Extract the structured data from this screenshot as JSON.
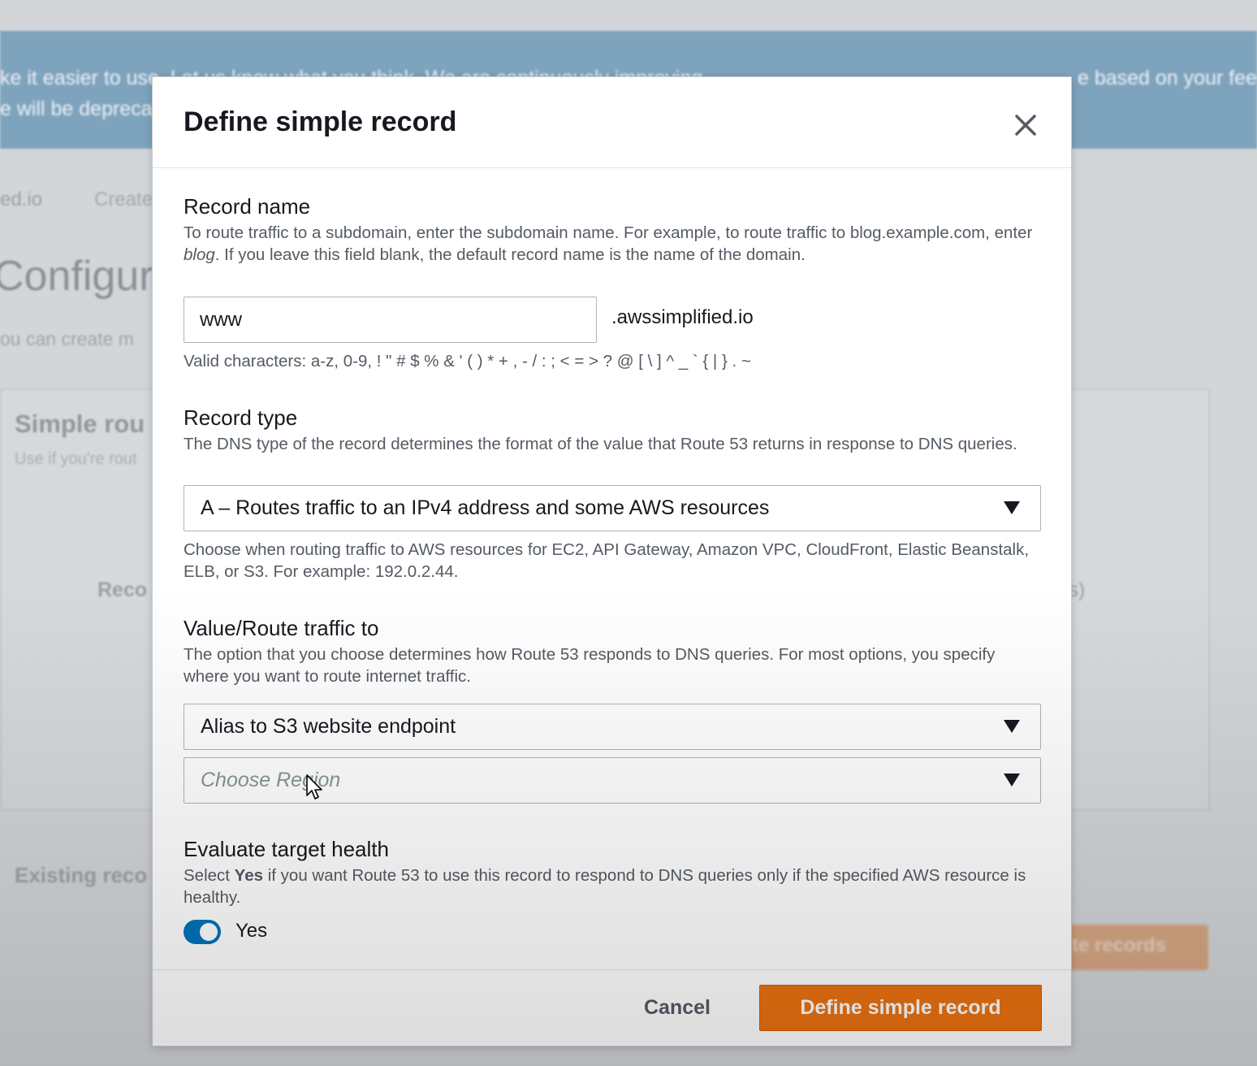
{
  "background": {
    "banner_line1": "ke it easier to use. Let us know what you think. We are continuously improving",
    "banner_line2": "e will be deprecated",
    "banner_right": "e based on your fee",
    "breadcrumb_domain": "ed.io",
    "breadcrumb_create": "Create",
    "page_title": "Configur",
    "page_subtitle": "ou can create m",
    "panel_title": "Simple rou",
    "panel_subtitle": "Use if you're rout",
    "record_col": "Reco",
    "right_col": "ls)",
    "existing_records": "Existing reco",
    "create_records_button": "te records"
  },
  "modal": {
    "title": "Define simple record",
    "record_name": {
      "label": "Record name",
      "description_pre": "To route traffic to a subdomain, enter the subdomain name. For example, to route traffic to blog.example.com, enter ",
      "description_em": "blog",
      "description_post": ". If you leave this field blank, the default record name is the name of the domain.",
      "value": "www",
      "suffix": ".awssimplified.io",
      "hint": "Valid characters: a-z, 0-9, ! \" # $ % & ' ( ) * + , - / : ; < = > ? @ [ \\ ] ^ _ ` { | } . ~"
    },
    "record_type": {
      "label": "Record type",
      "description": "The DNS type of the record determines the format of the value that Route 53 returns in response to DNS queries.",
      "selected": "A – Routes traffic to an IPv4 address and some AWS resources",
      "help": "Choose when routing traffic to AWS resources for EC2, API Gateway, Amazon VPC, CloudFront, Elastic Beanstalk, ELB, or S3. For example: 192.0.2.44."
    },
    "value_route": {
      "label": "Value/Route traffic to",
      "description": "The option that you choose determines how Route 53 responds to DNS queries. For most options, you specify where you want to route internet traffic.",
      "selected": "Alias to S3 website endpoint",
      "region_placeholder": "Choose Region"
    },
    "evaluate_health": {
      "label": "Evaluate target health",
      "description_pre": "Select ",
      "description_bold": "Yes",
      "description_post": " if you want Route 53 to use this record to respond to DNS queries only if the specified AWS resource is healthy.",
      "toggle_label": "Yes",
      "toggle_on": true
    },
    "footer": {
      "cancel_label": "Cancel",
      "submit_label": "Define simple record"
    }
  },
  "colors": {
    "primary": "#ec7211",
    "toggle": "#0073bb",
    "text": "#16191f",
    "muted": "#545b64"
  },
  "icons": [
    "close-icon",
    "caret-down-icon",
    "mouse-cursor-icon"
  ]
}
